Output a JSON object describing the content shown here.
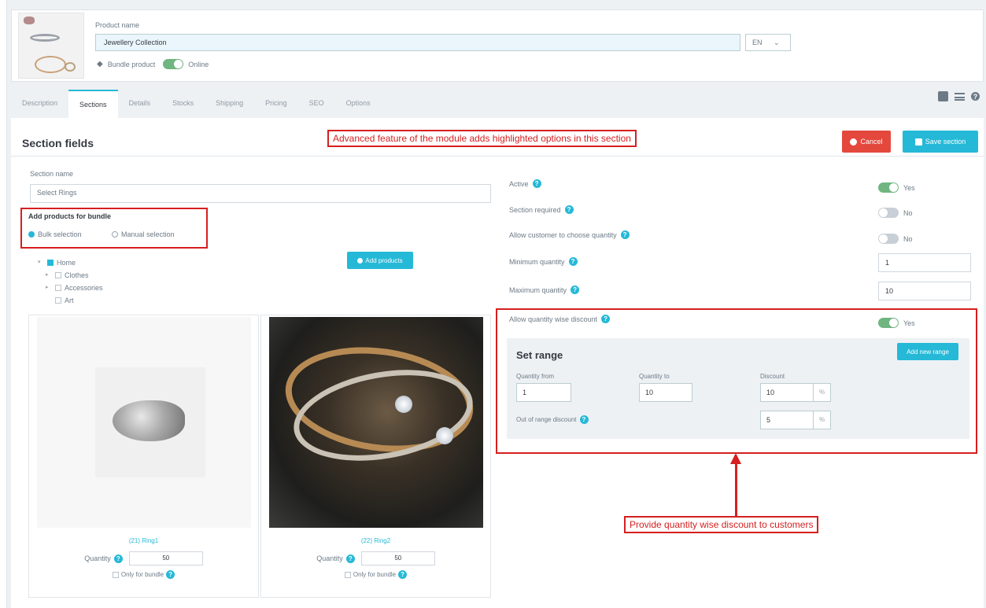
{
  "header": {
    "product_name_label": "Product name",
    "product_name_value": "Jewellery Collection",
    "language": "EN",
    "bundle_label": "Bundle product",
    "online_label": "Online"
  },
  "tabs": [
    {
      "label": "Description",
      "active": false
    },
    {
      "label": "Sections",
      "active": true
    },
    {
      "label": "Details",
      "active": false
    },
    {
      "label": "Stocks",
      "active": false
    },
    {
      "label": "Shipping",
      "active": false
    },
    {
      "label": "Pricing",
      "active": false
    },
    {
      "label": "SEO",
      "active": false
    },
    {
      "label": "Options",
      "active": false
    }
  ],
  "section": {
    "title": "Section fields",
    "cancel_label": "Cancel",
    "save_label": "Save section",
    "name_label": "Section name",
    "name_value": "Select Rings",
    "add_products_title": "Add products for bundle",
    "bulk_label": "Bulk selection",
    "manual_label": "Manual selection",
    "add_products_button": "Add products"
  },
  "tree": [
    {
      "label": "Home",
      "checked": true
    },
    {
      "label": "Clothes",
      "checked": false
    },
    {
      "label": "Accessories",
      "checked": false
    },
    {
      "label": "Art",
      "checked": false
    }
  ],
  "products": [
    {
      "name": "(21) Ring1",
      "quantity_label": "Quantity",
      "quantity": "50",
      "only_bundle_label": "Only for bundle"
    },
    {
      "name": "(22) Ring2",
      "quantity_label": "Quantity",
      "quantity": "50",
      "only_bundle_label": "Only for bundle"
    }
  ],
  "settings": {
    "active_label": "Active",
    "active_value": "Yes",
    "required_label": "Section required",
    "required_value": "No",
    "choose_qty_label": "Allow customer to choose quantity",
    "choose_qty_value": "No",
    "min_qty_label": "Minimum quantity",
    "min_qty_value": "1",
    "max_qty_label": "Maximum quantity",
    "max_qty_value": "10",
    "qty_discount_label": "Allow quantity wise discount",
    "qty_discount_value": "Yes"
  },
  "range": {
    "title": "Set range",
    "add_button": "Add new range",
    "from_label": "Quantity from",
    "from_value": "1",
    "to_label": "Quantity to",
    "to_value": "10",
    "discount_label": "Discount",
    "discount_value": "10",
    "pct": "%",
    "out_label": "Out of range discount",
    "out_value": "5"
  },
  "callouts": {
    "top": "Advanced feature of the module adds highlighted options in this section",
    "bottom": "Provide quantity wise discount to customers"
  },
  "colors": {
    "accent": "#25b9d7",
    "toggle_on": "#70b580",
    "cancel": "#e4483d",
    "annotation": "#d61f1f"
  }
}
